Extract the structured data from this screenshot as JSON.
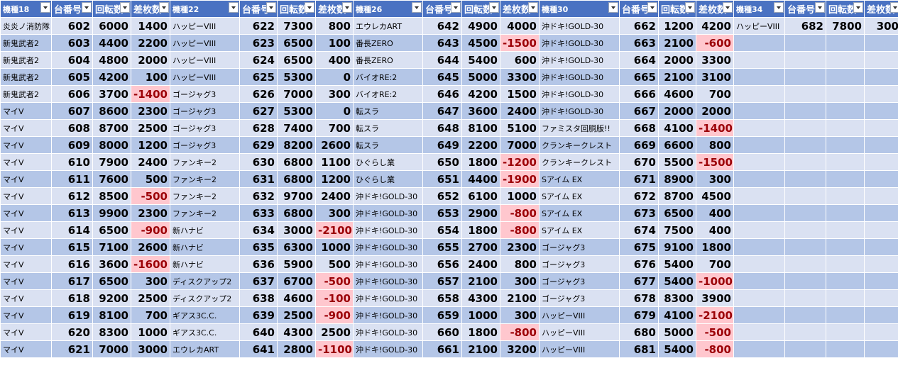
{
  "sheet": {
    "groups": [
      {
        "model_header": "機種18",
        "machine_header": "台番号",
        "spins_header": "回転数",
        "diff_header": "差枚数"
      },
      {
        "model_header": "機種22",
        "machine_header": "台番号",
        "spins_header": "回転数",
        "diff_header": "差枚数"
      },
      {
        "model_header": "機種26",
        "machine_header": "台番号",
        "spins_header": "回転数",
        "diff_header": "差枚数"
      },
      {
        "model_header": "機種30",
        "machine_header": "台番号",
        "spins_header": "回転数",
        "diff_header": "差枚数"
      },
      {
        "model_header": "機種34",
        "machine_header": "台番号",
        "spins_header": "回転数",
        "diff_header": "差枚数"
      }
    ],
    "rows": [
      [
        [
          "炎炎ノ消防隊",
          602,
          6000,
          1400
        ],
        [
          "ハッピーVIII",
          622,
          7300,
          800
        ],
        [
          "エウレカART",
          642,
          4900,
          4000
        ],
        [
          "沖ドキ!GOLD-30",
          662,
          1200,
          4200
        ],
        [
          "ハッピーVIII",
          682,
          7800,
          300
        ]
      ],
      [
        [
          "新鬼武者2",
          603,
          4400,
          2200
        ],
        [
          "ハッピーVIII",
          623,
          6500,
          100
        ],
        [
          "番長ZERO",
          643,
          4500,
          -1500
        ],
        [
          "沖ドキ!GOLD-30",
          663,
          2100,
          -600
        ],
        null
      ],
      [
        [
          "新鬼武者2",
          604,
          4800,
          2000
        ],
        [
          "ハッピーVIII",
          624,
          6500,
          400
        ],
        [
          "番長ZERO",
          644,
          5400,
          600
        ],
        [
          "沖ドキ!GOLD-30",
          664,
          2000,
          3300
        ],
        null
      ],
      [
        [
          "新鬼武者2",
          605,
          4200,
          100
        ],
        [
          "ハッピーVIII",
          625,
          5300,
          0
        ],
        [
          "バイオRE:2",
          645,
          5000,
          3300
        ],
        [
          "沖ドキ!GOLD-30",
          665,
          2100,
          3100
        ],
        null
      ],
      [
        [
          "新鬼武者2",
          606,
          3700,
          -1400
        ],
        [
          "ゴージャグ3",
          626,
          7000,
          300
        ],
        [
          "バイオRE:2",
          646,
          4200,
          1500
        ],
        [
          "沖ドキ!GOLD-30",
          666,
          4600,
          700
        ],
        null
      ],
      [
        [
          "マイV",
          607,
          8600,
          2300
        ],
        [
          "ゴージャグ3",
          627,
          5300,
          0
        ],
        [
          "転スラ",
          647,
          3600,
          2400
        ],
        [
          "沖ドキ!GOLD-30",
          667,
          2000,
          2000
        ],
        null
      ],
      [
        [
          "マイV",
          608,
          8700,
          2500
        ],
        [
          "ゴージャグ3",
          628,
          7400,
          700
        ],
        [
          "転スラ",
          648,
          8100,
          5100
        ],
        [
          "ファミスタ回胴版!!",
          668,
          4100,
          -1400
        ],
        null
      ],
      [
        [
          "マイV",
          609,
          8000,
          1200
        ],
        [
          "ゴージャグ3",
          629,
          8200,
          2600
        ],
        [
          "転スラ",
          649,
          2200,
          7000
        ],
        [
          "クランキークレスト",
          669,
          6600,
          800
        ],
        null
      ],
      [
        [
          "マイV",
          610,
          7900,
          2400
        ],
        [
          "ファンキー2",
          630,
          6800,
          1100
        ],
        [
          "ひぐらし業",
          650,
          1800,
          -1200
        ],
        [
          "クランキークレスト",
          670,
          5500,
          -1500
        ],
        null
      ],
      [
        [
          "マイV",
          611,
          7600,
          500
        ],
        [
          "ファンキー2",
          631,
          6800,
          1200
        ],
        [
          "ひぐらし業",
          651,
          4400,
          -1900
        ],
        [
          "Sアイム EX",
          671,
          8900,
          300
        ],
        null
      ],
      [
        [
          "マイV",
          612,
          8500,
          -500
        ],
        [
          "ファンキー2",
          632,
          9700,
          2400
        ],
        [
          "沖ドキ!GOLD-30",
          652,
          6100,
          1000
        ],
        [
          "Sアイム EX",
          672,
          8700,
          4500
        ],
        null
      ],
      [
        [
          "マイV",
          613,
          9900,
          2300
        ],
        [
          "ファンキー2",
          633,
          6800,
          300
        ],
        [
          "沖ドキ!GOLD-30",
          653,
          2900,
          -800
        ],
        [
          "Sアイム EX",
          673,
          6500,
          400
        ],
        null
      ],
      [
        [
          "マイV",
          614,
          6500,
          -900
        ],
        [
          "新ハナビ",
          634,
          3000,
          -2100
        ],
        [
          "沖ドキ!GOLD-30",
          654,
          1800,
          -800
        ],
        [
          "Sアイム EX",
          674,
          7500,
          400
        ],
        null
      ],
      [
        [
          "マイV",
          615,
          7100,
          2600
        ],
        [
          "新ハナビ",
          635,
          6300,
          1000
        ],
        [
          "沖ドキ!GOLD-30",
          655,
          2700,
          2300
        ],
        [
          "ゴージャグ3",
          675,
          9100,
          1800
        ],
        null
      ],
      [
        [
          "マイV",
          616,
          3600,
          -1600
        ],
        [
          "新ハナビ",
          636,
          5900,
          500
        ],
        [
          "沖ドキ!GOLD-30",
          656,
          2400,
          800
        ],
        [
          "ゴージャグ3",
          676,
          5400,
          700
        ],
        null
      ],
      [
        [
          "マイV",
          617,
          6500,
          300
        ],
        [
          "ディスクアップ2",
          637,
          6700,
          -500
        ],
        [
          "沖ドキ!GOLD-30",
          657,
          2100,
          300
        ],
        [
          "ゴージャグ3",
          677,
          5400,
          -1000
        ],
        null
      ],
      [
        [
          "マイV",
          618,
          9200,
          2500
        ],
        [
          "ディスクアップ2",
          638,
          4600,
          -100
        ],
        [
          "沖ドキ!GOLD-30",
          658,
          4300,
          2100
        ],
        [
          "ゴージャグ3",
          678,
          8300,
          3900
        ],
        null
      ],
      [
        [
          "マイV",
          619,
          8100,
          700
        ],
        [
          "ギアス3C.C.",
          639,
          2500,
          -900
        ],
        [
          "沖ドキ!GOLD-30",
          659,
          1000,
          300
        ],
        [
          "ハッピーVIII",
          679,
          4100,
          -2100
        ],
        null
      ],
      [
        [
          "マイV",
          620,
          8300,
          1000
        ],
        [
          "ギアス3C.C.",
          640,
          4300,
          2500
        ],
        [
          "沖ドキ!GOLD-30",
          660,
          1800,
          -800
        ],
        [
          "ハッピーVIII",
          680,
          5000,
          -500
        ],
        null
      ],
      [
        [
          "マイV",
          621,
          7000,
          3000
        ],
        [
          "エウレカART",
          641,
          2800,
          -1100
        ],
        [
          "沖ドキ!GOLD-30",
          661,
          2100,
          3200
        ],
        [
          "ハッピーVIII",
          681,
          5400,
          -800
        ],
        null
      ]
    ]
  }
}
